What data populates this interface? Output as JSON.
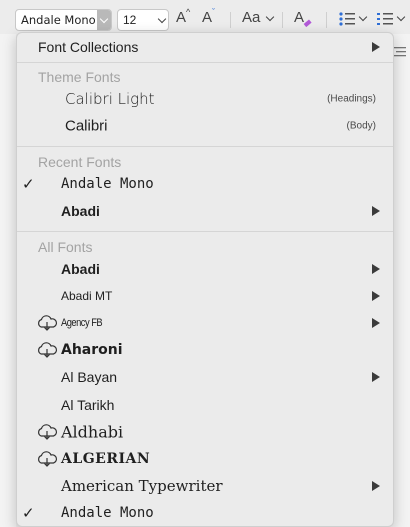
{
  "toolbar": {
    "font_name": "Andale Mono",
    "font_size": "12",
    "grow_font": "A",
    "shrink_font": "A",
    "change_case": "Aa",
    "clear_format": "A"
  },
  "menu": {
    "collections": {
      "label": "Font Collections"
    },
    "theme_header": "Theme Fonts",
    "theme_fonts": [
      {
        "label": "Calibri Light",
        "note": "(Headings)"
      },
      {
        "label": "Calibri",
        "note": "(Body)"
      }
    ],
    "recent_header": "Recent Fonts",
    "recent_fonts": [
      {
        "label": "Andale Mono",
        "checked": true
      },
      {
        "label": "Abadi",
        "submenu": true
      }
    ],
    "all_header": "All Fonts",
    "all_fonts": [
      {
        "label": "Abadi",
        "submenu": true,
        "cloud": false
      },
      {
        "label": "Abadi MT",
        "submenu": true,
        "cloud": false
      },
      {
        "label": "Agency FB",
        "submenu": true,
        "cloud": true
      },
      {
        "label": "Aharoni",
        "submenu": false,
        "cloud": true
      },
      {
        "label": "Al Bayan",
        "submenu": true,
        "cloud": false
      },
      {
        "label": "Al Tarikh",
        "submenu": false,
        "cloud": false
      },
      {
        "label": "Aldhabi",
        "submenu": false,
        "cloud": true
      },
      {
        "label": "ALGERIAN",
        "submenu": false,
        "cloud": true
      },
      {
        "label": "American Typewriter",
        "submenu": true,
        "cloud": false
      },
      {
        "label": "Andale Mono",
        "submenu": false,
        "cloud": false,
        "checked": true
      }
    ],
    "check_glyph": "✓"
  }
}
